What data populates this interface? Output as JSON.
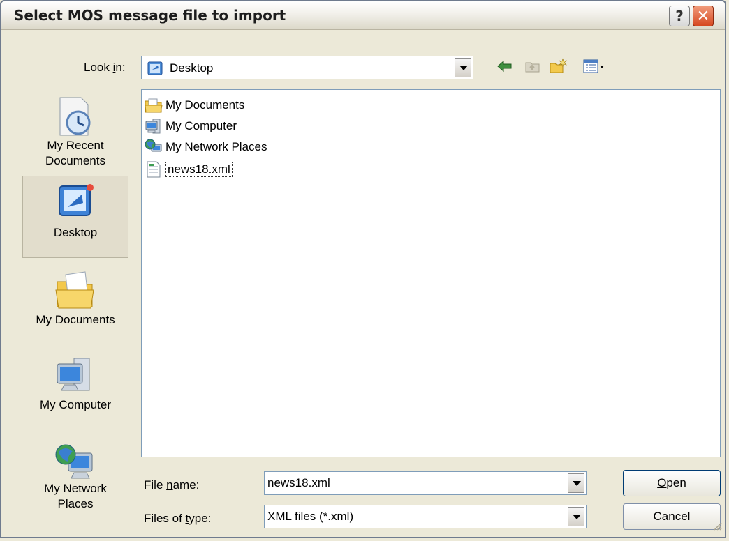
{
  "window": {
    "title": "Select MOS message file to import",
    "help_glyph": "?",
    "close_glyph": "✕"
  },
  "lookin": {
    "label_pre": "Look ",
    "label_u": "i",
    "label_post": "n:",
    "value": "Desktop"
  },
  "toolbar": {
    "icons": [
      "back-arrow-icon",
      "up-folder-icon",
      "new-folder-icon",
      "view-menu-icon"
    ]
  },
  "places": [
    {
      "line1": "My Recent",
      "line2": "Documents",
      "icon": "recent-documents-icon"
    },
    {
      "line1": "Desktop",
      "line2": "",
      "icon": "desktop-icon",
      "selected": true
    },
    {
      "line1": "My Documents",
      "line2": "",
      "icon": "my-documents-icon"
    },
    {
      "line1": "My Computer",
      "line2": "",
      "icon": "my-computer-icon"
    },
    {
      "line1": "My Network",
      "line2": "Places",
      "icon": "network-places-icon"
    }
  ],
  "files": [
    {
      "name": "My Documents",
      "icon": "folder-documents-icon"
    },
    {
      "name": "My Computer",
      "icon": "computer-icon"
    },
    {
      "name": "My Network Places",
      "icon": "network-icon"
    },
    {
      "name": "news18.xml",
      "icon": "xml-file-icon",
      "focused": true
    }
  ],
  "filename": {
    "label_pre": "File ",
    "label_u": "n",
    "label_post": "ame:",
    "value": "news18.xml"
  },
  "filetype": {
    "label_pre": "Files of ",
    "label_u": "t",
    "label_post": "ype:",
    "value": "XML files (*.xml)"
  },
  "buttons": {
    "open_u": "O",
    "open_rest": "pen",
    "cancel": "Cancel"
  },
  "colors": {
    "dialog_bg": "#ece9d8",
    "field_border": "#7f9db9",
    "close_red": "#d64820"
  }
}
